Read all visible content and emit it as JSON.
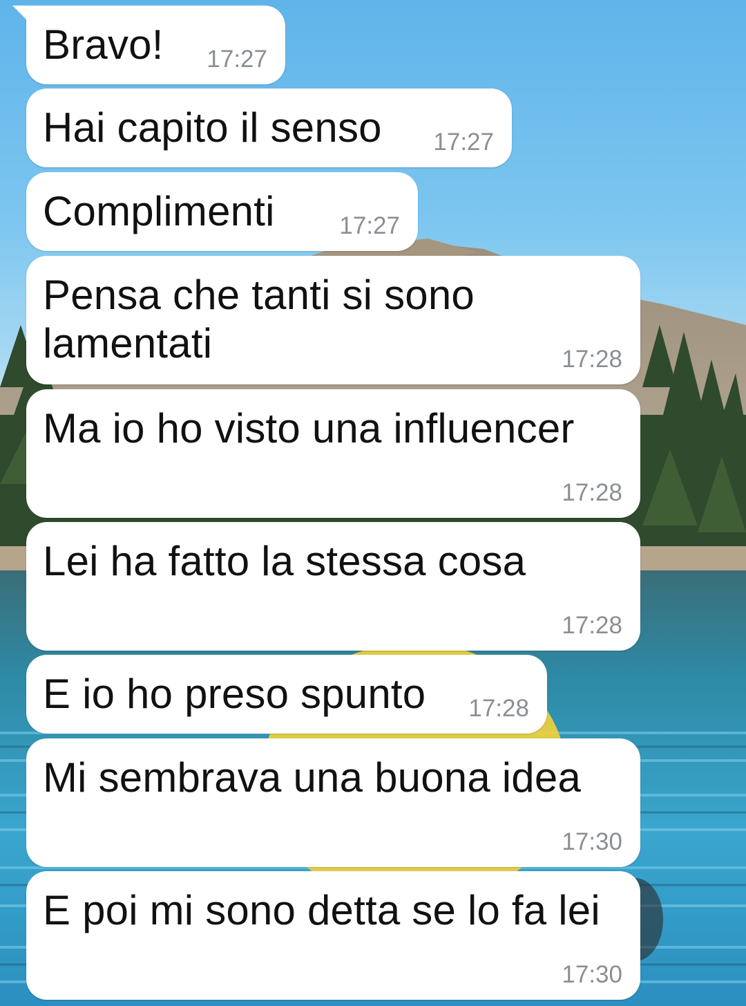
{
  "messages": [
    {
      "text": "Bravo!",
      "time": "17:27"
    },
    {
      "text": "Hai capito il senso",
      "time": "17:27"
    },
    {
      "text": "Complimenti",
      "time": "17:27"
    },
    {
      "text": "Pensa che tanti si sono\nlamentati",
      "time": "17:28"
    },
    {
      "text": "Ma io ho visto una influencer",
      "time": "17:28"
    },
    {
      "text": "Lei ha fatto la stessa cosa",
      "time": "17:28"
    },
    {
      "text": "E io ho preso spunto",
      "time": "17:28"
    },
    {
      "text": "Mi sembrava una buona idea",
      "time": "17:30"
    },
    {
      "text": "E poi mi sono detta se lo fa lei",
      "time": "17:30"
    }
  ],
  "colors": {
    "bubble": "#ffffff",
    "text": "#111111",
    "time": "#8a8f94",
    "sky": "#6cbdee",
    "lake": "#2f8fb0"
  }
}
